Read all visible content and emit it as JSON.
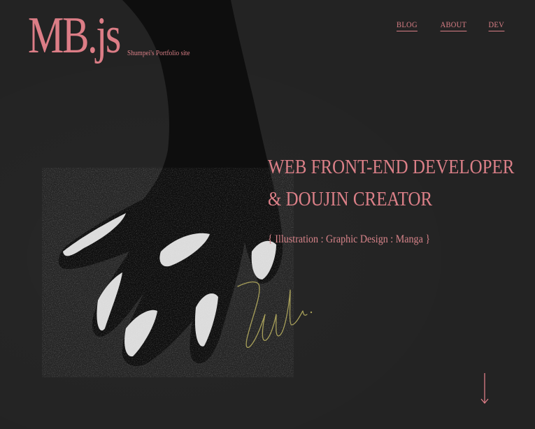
{
  "site": {
    "logo": "MB.js",
    "subtitle": "Shumpei's Portfolio site"
  },
  "nav": {
    "items": [
      {
        "label": "BLOG"
      },
      {
        "label": "ABOUT"
      },
      {
        "label": "DEV"
      }
    ]
  },
  "hero": {
    "line1": "WEB FRONT-END DEVELOPER",
    "line2": "& DOUJIN CREATOR",
    "tags": "{ Illustration : Graphic Design : Manga }"
  },
  "colors": {
    "background": "#232323",
    "accent": "#dc7d86",
    "signature": "#a8a05a"
  },
  "icons": {
    "scroll": "arrow-down-icon"
  }
}
